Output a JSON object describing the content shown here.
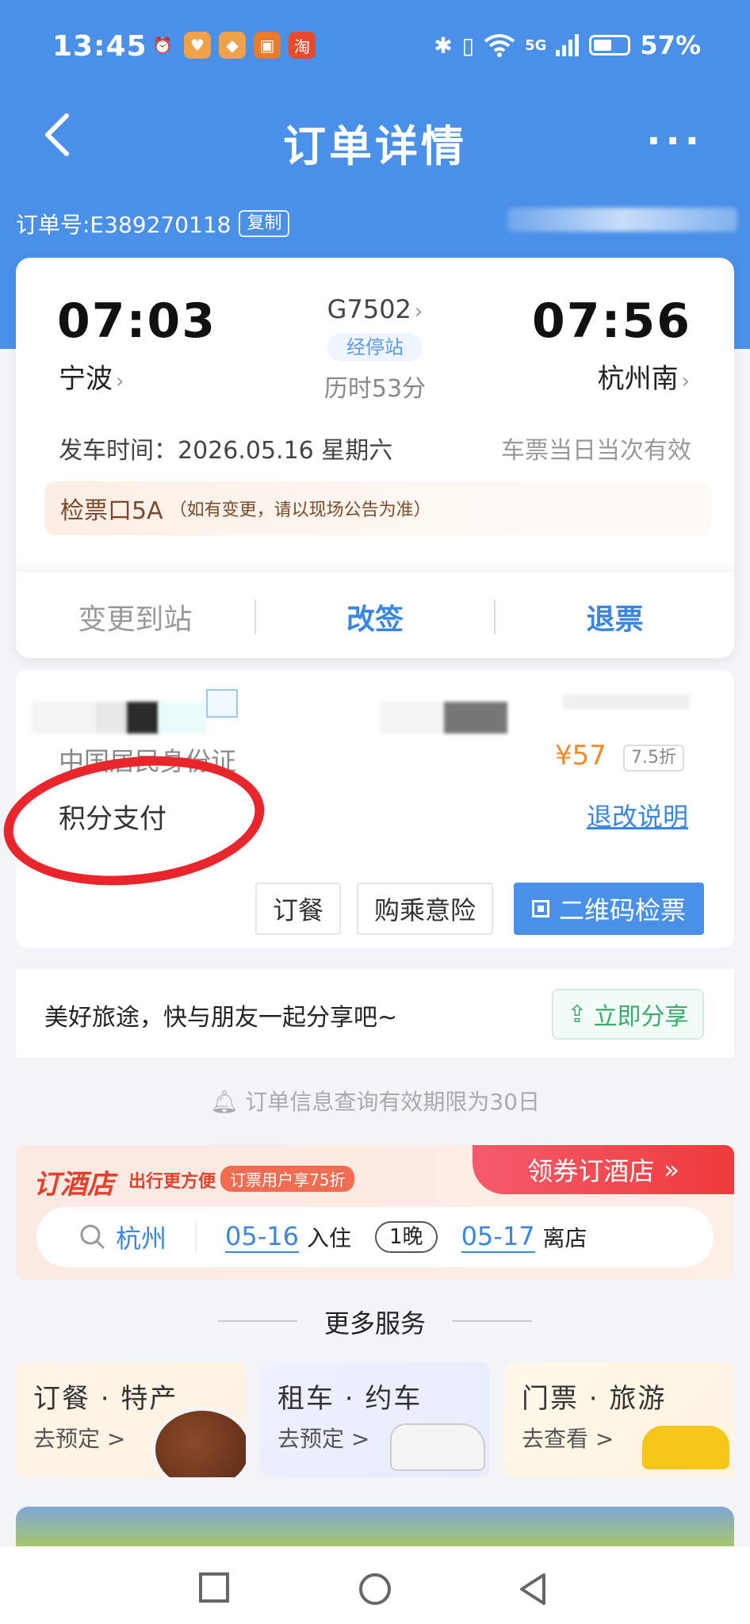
{
  "status_bar": {
    "time": "13:45",
    "network": "5G",
    "battery": "57%"
  },
  "nav": {
    "title": "订单详情",
    "more": "···"
  },
  "order": {
    "label": "订单号:E389270118",
    "copy": "复制"
  },
  "trip": {
    "dep_time": "07:03",
    "dep_station": "宁波",
    "arr_time": "07:56",
    "arr_station": "杭州南",
    "train_no": "G7502",
    "stops": "经停站",
    "duration": "历时53分",
    "dep_date": "发车时间：2026.05.16 星期六",
    "validity": "车票当日当次有效",
    "gate": "检票口5A",
    "gate_note": "（如有变更，请以现场公告为准）"
  },
  "actions": {
    "change_station": "变更到站",
    "reschedule": "改签",
    "refund": "退票"
  },
  "passenger": {
    "id_type": "中国居民身份证",
    "price": "¥57",
    "discount": "7.5折",
    "payment": "积分支付",
    "refund_rules": "退改说明",
    "btn_meal": "订餐",
    "btn_insurance": "购乘意险",
    "btn_qr": "二维码检票"
  },
  "share": {
    "text": "美好旅途，快与朋友一起分享吧~",
    "button": "立即分享"
  },
  "notice": "订单信息查询有效期限为30日",
  "hotel": {
    "title": "订酒店",
    "subtitle": "出行更方便",
    "tag": "订票用户享75折",
    "cta": "领券订酒店",
    "city": "杭州",
    "checkin_date": "05-16",
    "checkin_label": "入住",
    "nights": "1晚",
    "checkout_date": "05-17",
    "checkout_label": "离店"
  },
  "more_services": {
    "title": "更多服务",
    "items": [
      {
        "title": "订餐 · 特产",
        "sub": "去预定 >"
      },
      {
        "title": "租车 · 约车",
        "sub": "去预定 >"
      },
      {
        "title": "门票 · 旅游",
        "sub": "去查看 >"
      }
    ]
  },
  "colors": {
    "primary": "#4a90e8",
    "accent_orange": "#ee8a2c",
    "annotation_red": "#e8262b"
  }
}
